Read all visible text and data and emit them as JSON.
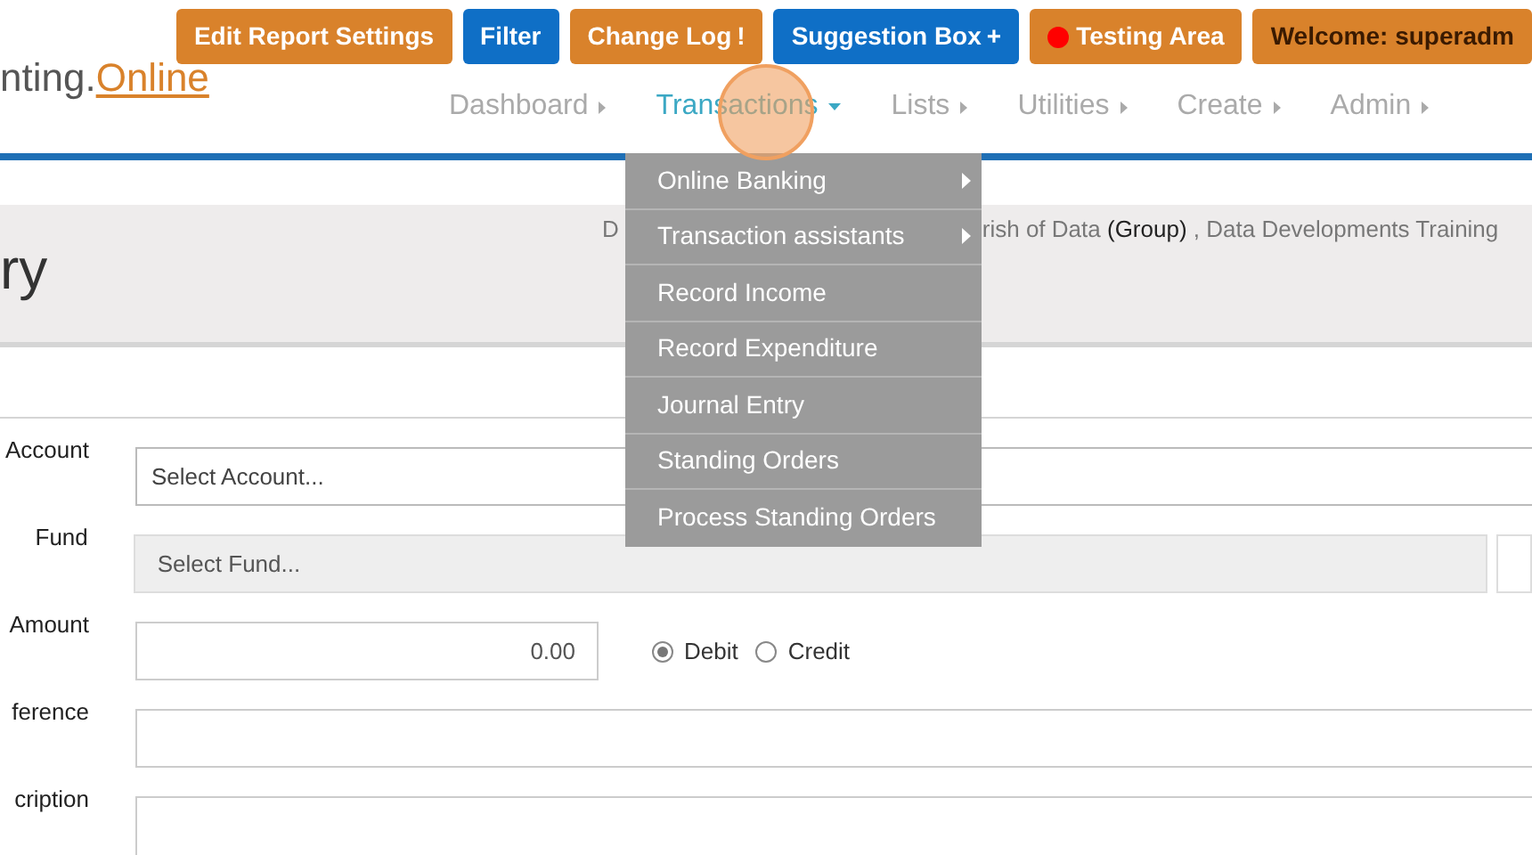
{
  "top_buttons": [
    {
      "label": "Edit Report Settings",
      "kind": "orange"
    },
    {
      "label": "Filter",
      "kind": "blue"
    },
    {
      "label": "Change Log",
      "kind": "orange",
      "suffix": "!"
    },
    {
      "label": "Suggestion Box",
      "kind": "blue",
      "suffix": "+"
    },
    {
      "label": "Testing Area",
      "kind": "orange",
      "color": "#ff0000"
    },
    {
      "label": "Welcome:  superadm",
      "kind": "welcome"
    }
  ],
  "logo": {
    "part1": "nting.",
    "part2": "Online"
  },
  "nav": [
    {
      "label": "Dashboard",
      "selected": false
    },
    {
      "label": "Transactions",
      "selected": true
    },
    {
      "label": "Lists",
      "selected": false
    },
    {
      "label": "Utilities",
      "selected": false
    },
    {
      "label": "Create",
      "selected": false
    },
    {
      "label": "Admin",
      "selected": false
    }
  ],
  "dropdown": [
    {
      "label": "Online Banking",
      "submenu": true
    },
    {
      "label": "Transaction assistants",
      "submenu": true
    },
    {
      "label": "Record Income",
      "submenu": false
    },
    {
      "label": "Record Expenditure",
      "submenu": false
    },
    {
      "label": "Journal Entry",
      "submenu": false
    },
    {
      "label": "Standing Orders",
      "submenu": false
    },
    {
      "label": "Process Standing Orders",
      "submenu": false
    }
  ],
  "header": {
    "title": "ry",
    "breadcrumb_start": "D",
    "breadcrumb_rest": "rish of Data **(Group)** , Data Developments Training"
  },
  "form": {
    "account": {
      "label": "Account",
      "placeholder": "Select Account..."
    },
    "fund": {
      "label": "Fund",
      "placeholder": "Select Fund..."
    },
    "amount": {
      "label": "Amount",
      "value": "0.00"
    },
    "direction": [
      {
        "label": "Debit",
        "selected": true
      },
      {
        "label": "Credit",
        "selected": false
      }
    ],
    "reference": {
      "label": "ference"
    },
    "description": {
      "label": "cription"
    }
  }
}
